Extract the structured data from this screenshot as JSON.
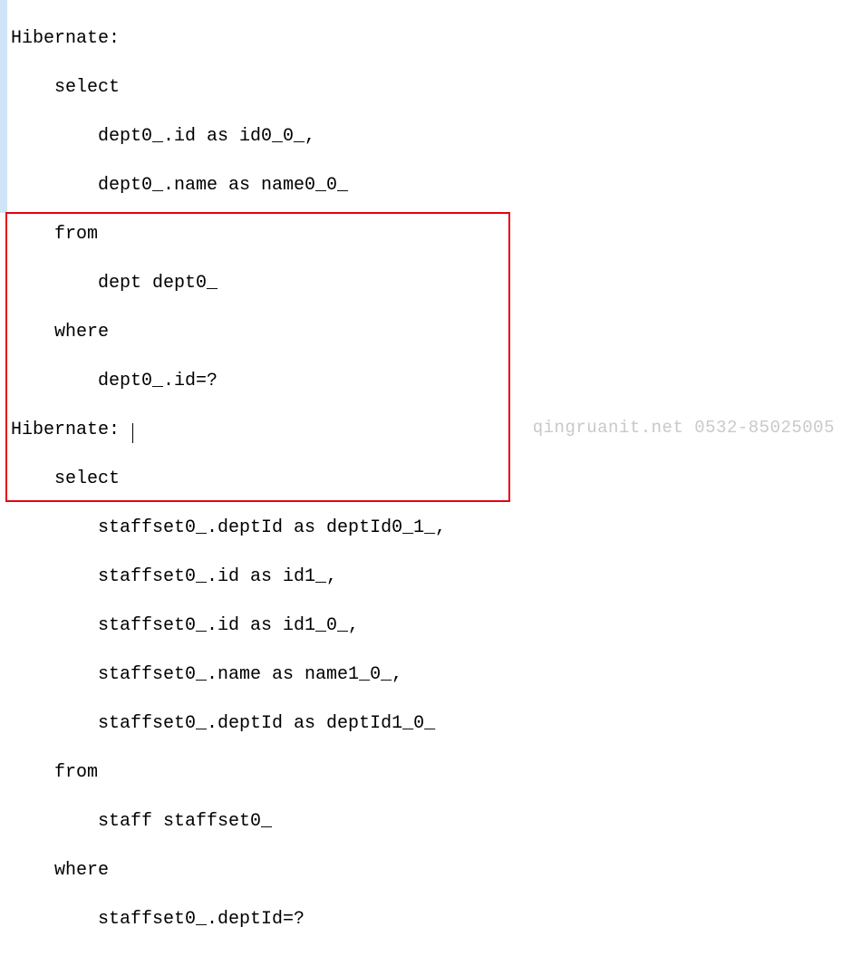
{
  "query1": {
    "l1": "Hibernate: ",
    "l2": "    select",
    "l3": "        dept0_.id as id0_0_,",
    "l4": "        dept0_.name as name0_0_ ",
    "l5": "    from",
    "l6": "        dept dept0_ ",
    "l7": "    where",
    "l8": "        dept0_.id=?"
  },
  "query2": {
    "l1a": "Hibernate: ",
    "l2": "    select",
    "l3": "        staffset0_.deptId as deptId0_1_,",
    "l4": "        staffset0_.id as id1_,",
    "l5": "        staffset0_.id as id1_0_,",
    "l6": "        staffset0_.name as name1_0_,",
    "l7": "        staffset0_.deptId as deptId1_0_ ",
    "l8": "    from",
    "l9": "        staff staffset0_ ",
    "l10": "    where",
    "l11": "        staffset0_.deptId=?"
  },
  "watermark": "qingruanit.net 0532-85025005"
}
